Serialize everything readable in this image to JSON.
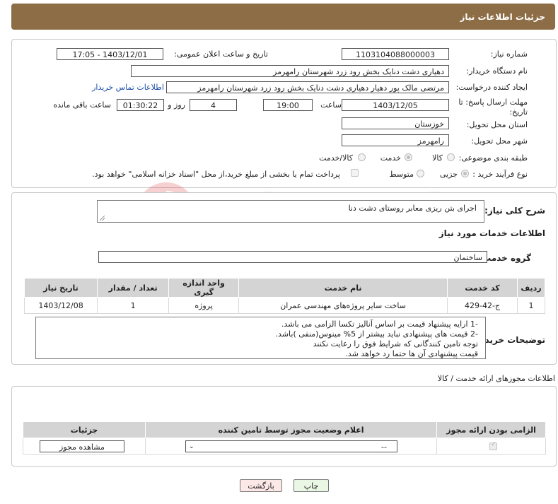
{
  "header": {
    "title": "جزئیات اطلاعات نیاز"
  },
  "form": {
    "need_number_label": "شماره نیاز:",
    "need_number": "1103104088000003",
    "announce_label": "تاریخ و ساعت اعلان عمومی:",
    "announce_value": "1403/12/01 - 17:05",
    "buyer_org_label": "نام دستگاه خریدار:",
    "buyer_org": "دهیاری دشت دنایک بخش رود زرد شهرستان رامهرمز",
    "creator_label": "ایجاد کننده درخواست:",
    "creator": "مرتضی مالک پور دهیار دهیاری دشت دنایک بخش رود زرد شهرستان رامهرمز",
    "contact_link": "اطلاعات تماس خریدار",
    "deadline_label": "مهلت ارسال پاسخ: تا تاریخ:",
    "deadline_date": "1403/12/05",
    "time_label": "ساعت",
    "deadline_time": "19:00",
    "days_value": "4",
    "days_label": "روز و",
    "remaining_time": "01:30:22",
    "remaining_label": "ساعت باقی مانده",
    "province_label": "استان محل تحویل:",
    "province": "خوزستان",
    "city_label": "شهر محل تحویل:",
    "city": "رامهرمز",
    "category_label": "طبقه بندی موضوعی:",
    "category_options": [
      "کالا",
      "خدمت",
      "کالا/خدمت"
    ],
    "category_selected": "خدمت",
    "process_label": "نوع فرآیند خرید :",
    "process_options": [
      "جزیی",
      "متوسط"
    ],
    "process_selected": "جزیی",
    "payment_note": "پرداخت تمام یا بخشی از مبلغ خرید،از محل \"اسناد خزانه اسلامی\" خواهد بود."
  },
  "summary": {
    "desc_label": "شرح کلی نیاز:",
    "desc_value": "اجرای بتن ریزی معابر روستای دشت دنا",
    "services_title": "اطلاعات خدمات مورد نیاز",
    "group_label": "گروه خدمت:",
    "group_value": "ساختمان",
    "table_headers": [
      "ردیف",
      "کد خدمت",
      "نام خدمت",
      "واحد اندازه گیری",
      "تعداد / مقدار",
      "تاریخ نیاز"
    ],
    "table_rows": [
      [
        "1",
        "ج-42-429",
        "ساخت سایر پروژه‌های مهندسی عمران",
        "پروژه",
        "1",
        "1403/12/08"
      ]
    ],
    "buyer_notes_label": "توضیحات خریدار:",
    "buyer_notes": [
      "-1 ارایه پیشنهاد قیمت بر اساس آنالیز تکسا الزامی می باشد.",
      "-2 قیمت های پیشنهادی نباید بیشتر از 5% مینوس(منفی )باشد.",
      " توجه تامین کنندگانی که شرایط فوق را رعایت نکنند",
      "قیمت پیشنهادی آن ها حتما رد خواهد شد."
    ]
  },
  "permits": {
    "title": "اطلاعات مجوزهای ارائه خدمت / کالا",
    "headers": [
      "الزامی بودن ارائه مجوز",
      "اعلام وضعیت مجوز توسط تامین کننده",
      "جزئیات"
    ],
    "select_value": "--",
    "view_button": "مشاهده مجوز"
  },
  "actions": {
    "print": "چاپ",
    "back": "بازگشت"
  },
  "watermark": {
    "text": "AriaTender.neT"
  },
  "colors": {
    "header_bg": "#8c6d45",
    "link": "#1a4ea8",
    "back_bg": "#fde8e8",
    "print_bg": "#eaf7e4"
  }
}
